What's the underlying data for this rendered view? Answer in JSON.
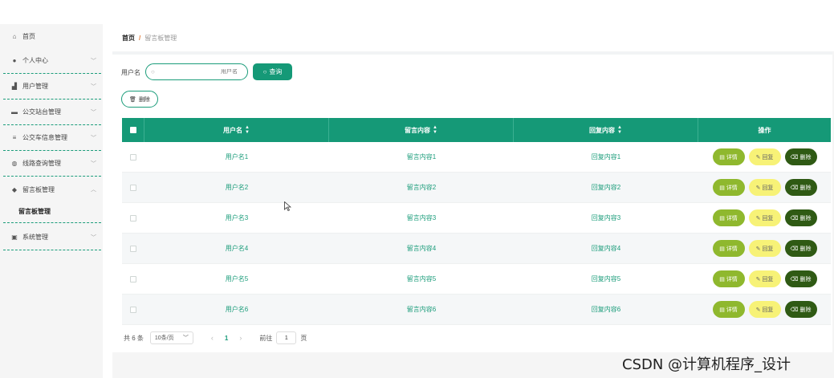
{
  "sidebar": {
    "items": [
      {
        "label": "首页",
        "icon": "home-icon"
      },
      {
        "label": "个人中心",
        "icon": "user-icon"
      },
      {
        "label": "用户管理",
        "icon": "users-icon"
      },
      {
        "label": "公交站台管理",
        "icon": "monitor-icon"
      },
      {
        "label": "公交车信息管理",
        "icon": "list-icon"
      },
      {
        "label": "线路查询管理",
        "icon": "globe-icon"
      },
      {
        "label": "留言板管理",
        "icon": "location-icon"
      },
      {
        "label": "系统管理",
        "icon": "clipboard-icon"
      }
    ],
    "sub_item": "留言板管理"
  },
  "breadcrumb": {
    "home": "首页",
    "separator": "/",
    "current": "留言板管理"
  },
  "search": {
    "label": "用户名",
    "placeholder": "用户名",
    "query_button": "查询"
  },
  "actions": {
    "delete_button": "删除"
  },
  "table": {
    "headers": [
      "用户名",
      "留言内容",
      "回复内容",
      "操作"
    ],
    "rows": [
      {
        "username": "用户名1",
        "message": "留言内容1",
        "reply": "回复内容1"
      },
      {
        "username": "用户名2",
        "message": "留言内容2",
        "reply": "回复内容2"
      },
      {
        "username": "用户名3",
        "message": "留言内容3",
        "reply": "回复内容3"
      },
      {
        "username": "用户名4",
        "message": "留言内容4",
        "reply": "回复内容4"
      },
      {
        "username": "用户名5",
        "message": "留言内容5",
        "reply": "回复内容5"
      },
      {
        "username": "用户名6",
        "message": "留言内容6",
        "reply": "回复内容6"
      }
    ],
    "op_labels": {
      "detail": "详情",
      "reply": "回复",
      "delete": "删除"
    }
  },
  "pagination": {
    "total": "共 6 条",
    "page_size": "10条/页",
    "current_page": "1",
    "goto_label": "前往",
    "goto_value": "1",
    "page_suffix": "页"
  },
  "watermark": "CSDN @计算机程序_设计",
  "colors": {
    "primary": "#159977",
    "detail": "#8fb82e",
    "reply": "#f7f277",
    "delete": "#2f5a14"
  }
}
